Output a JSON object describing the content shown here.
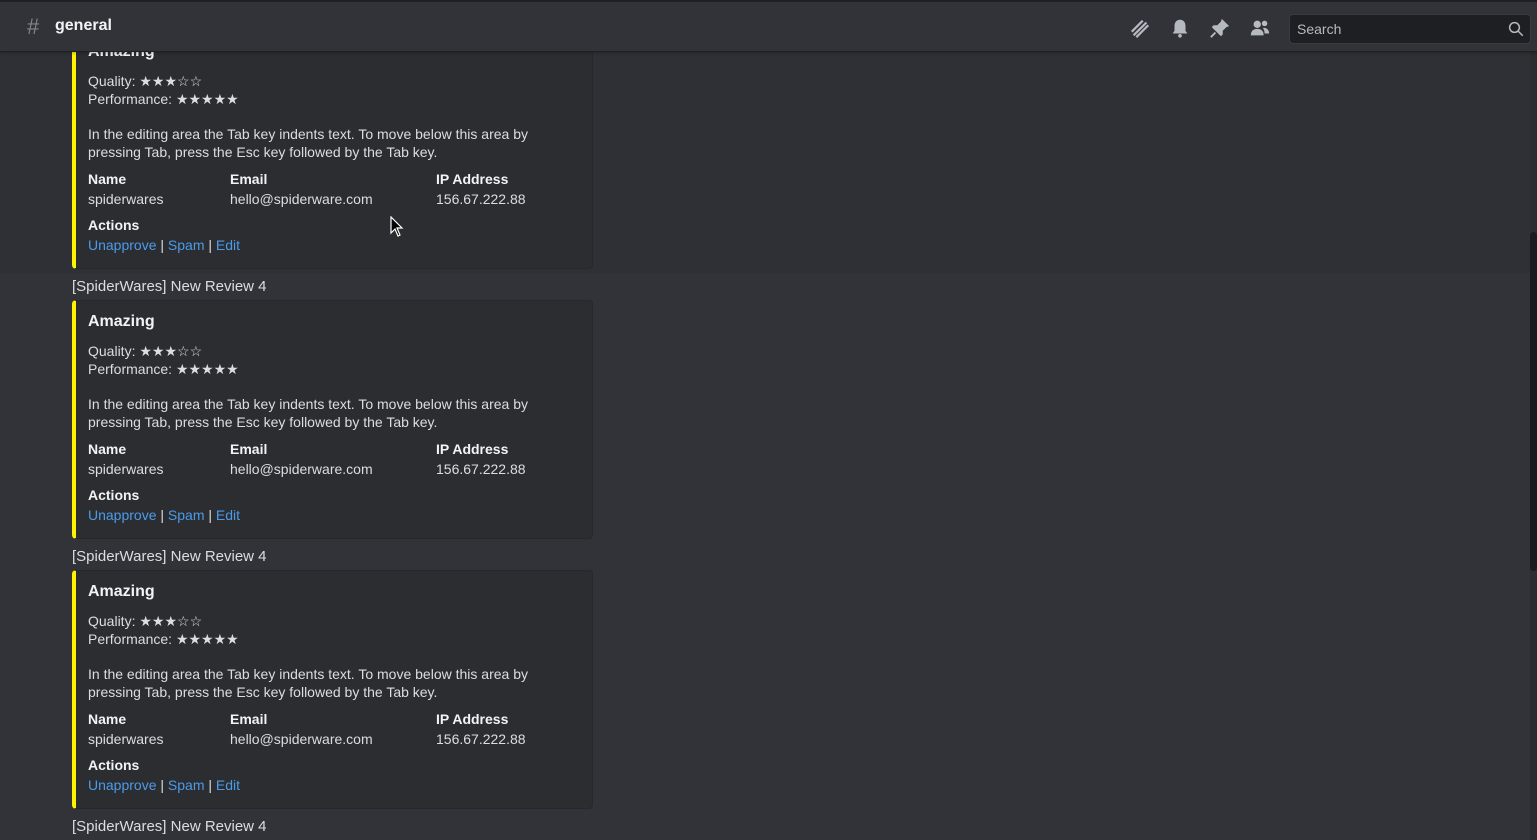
{
  "header": {
    "channel_name": "general",
    "search_placeholder": "Search",
    "icons": [
      "threads-icon",
      "bell-icon",
      "pin-icon",
      "members-icon",
      "search-icon"
    ]
  },
  "reviews": [
    {
      "title": "",
      "heading": "Amazing",
      "quality_label": "Quality:",
      "quality_stars": "★★★☆☆",
      "performance_label": "Performance:",
      "performance_stars": "★★★★★",
      "description": "In the editing area the Tab key indents text. To move below this area by pressing Tab, press the Esc key followed by the Tab key.",
      "fields": {
        "name_label": "Name",
        "name_value": "spiderwares",
        "email_label": "Email",
        "email_value": "hello@spiderware.com",
        "ip_label": "IP Address",
        "ip_value": "156.67.222.88"
      },
      "actions_label": "Actions",
      "actions": {
        "unapprove": "Unapprove",
        "spam": "Spam",
        "edit": "Edit",
        "sep": "|"
      }
    },
    {
      "title": "[SpiderWares] New Review 4",
      "heading": "Amazing",
      "quality_label": "Quality:",
      "quality_stars": "★★★☆☆",
      "performance_label": "Performance:",
      "performance_stars": "★★★★★",
      "description": "In the editing area the Tab key indents text. To move below this area by pressing Tab, press the Esc key followed by the Tab key.",
      "fields": {
        "name_label": "Name",
        "name_value": "spiderwares",
        "email_label": "Email",
        "email_value": "hello@spiderware.com",
        "ip_label": "IP Address",
        "ip_value": "156.67.222.88"
      },
      "actions_label": "Actions",
      "actions": {
        "unapprove": "Unapprove",
        "spam": "Spam",
        "edit": "Edit",
        "sep": "|"
      }
    },
    {
      "title": "[SpiderWares] New Review 4",
      "heading": "Amazing",
      "quality_label": "Quality:",
      "quality_stars": "★★★☆☆",
      "performance_label": "Performance:",
      "performance_stars": "★★★★★",
      "description": "In the editing area the Tab key indents text. To move below this area by pressing Tab, press the Esc key followed by the Tab key.",
      "fields": {
        "name_label": "Name",
        "name_value": "spiderwares",
        "email_label": "Email",
        "email_value": "hello@spiderware.com",
        "ip_label": "IP Address",
        "ip_value": "156.67.222.88"
      },
      "actions_label": "Actions",
      "actions": {
        "unapprove": "Unapprove",
        "spam": "Spam",
        "edit": "Edit",
        "sep": "|"
      }
    },
    {
      "title": "[SpiderWares] New Review 4"
    }
  ],
  "colors": {
    "embed_accent": "#fff200",
    "link": "#4c9be8",
    "background": "#313338"
  }
}
